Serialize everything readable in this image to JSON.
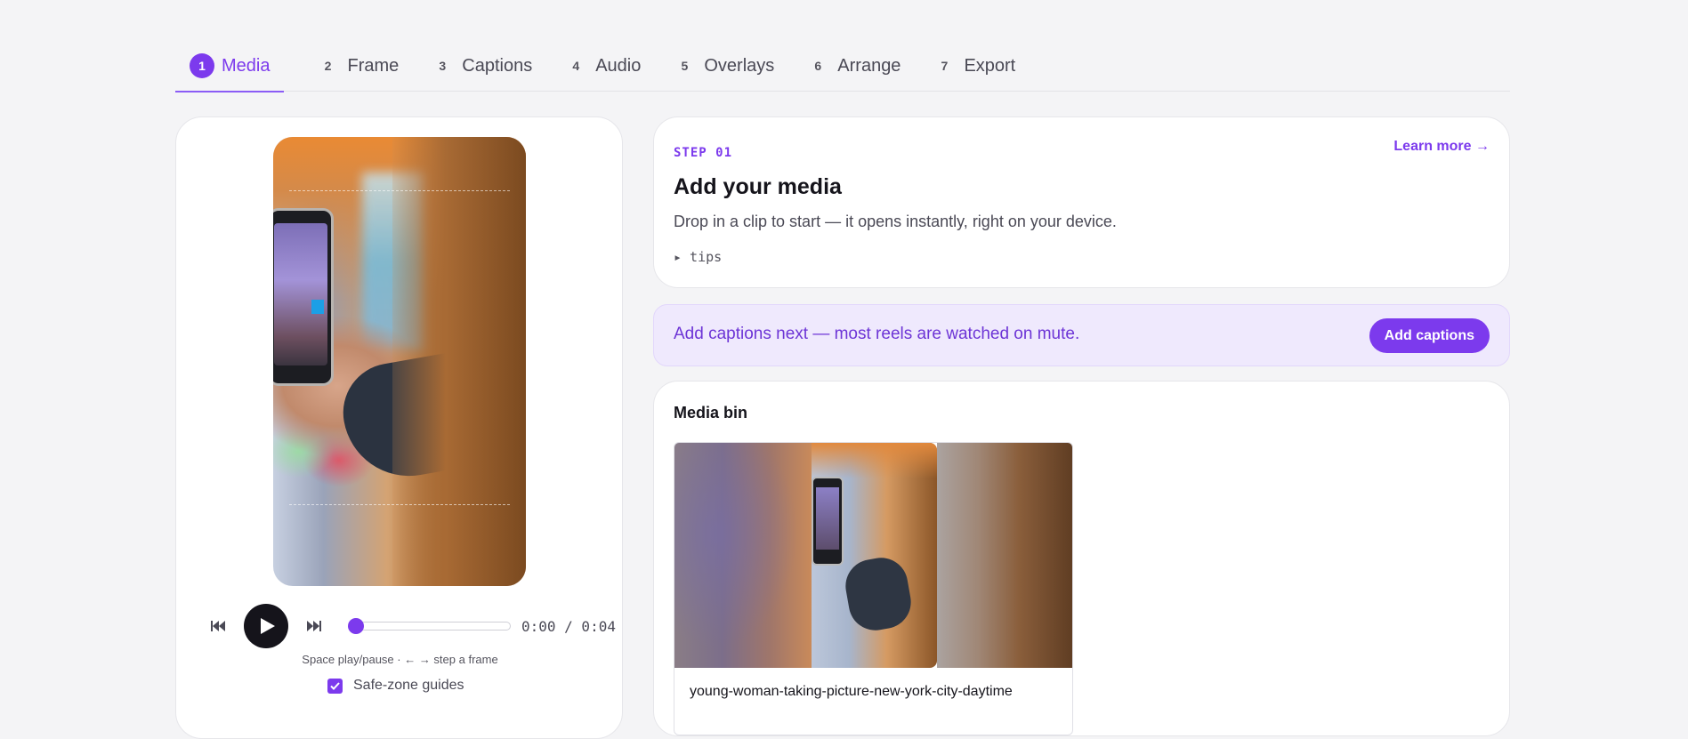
{
  "tabs": [
    {
      "num": "1",
      "label": "Media",
      "active": true
    },
    {
      "num": "2",
      "label": "Frame"
    },
    {
      "num": "3",
      "label": "Captions"
    },
    {
      "num": "4",
      "label": "Audio"
    },
    {
      "num": "5",
      "label": "Overlays"
    },
    {
      "num": "6",
      "label": "Arrange"
    },
    {
      "num": "7",
      "label": "Export"
    }
  ],
  "preview": {
    "time_display": "0:00 / 0:04",
    "progress": 0,
    "hint": "Space play/pause · ← → step a frame",
    "safe_zone_label": "Safe-zone guides",
    "safe_zone_checked": true
  },
  "step": {
    "label": "STEP 01",
    "title": "Add your media",
    "description": "Drop in a clip to start — it opens instantly, right on your device.",
    "tips": "▸ tips",
    "learn_more": "Learn more →"
  },
  "banner": {
    "text": "Add captions next — most reels are watched on mute.",
    "button": "Add captions"
  },
  "media_bin": {
    "title": "Media bin",
    "clips": [
      {
        "name": "young-woman-taking-picture-new-york-city-daytime"
      }
    ]
  },
  "colors": {
    "accent": "#7c3aed",
    "banner_bg": "#efe9fd",
    "page_bg": "#f4f4f6"
  }
}
